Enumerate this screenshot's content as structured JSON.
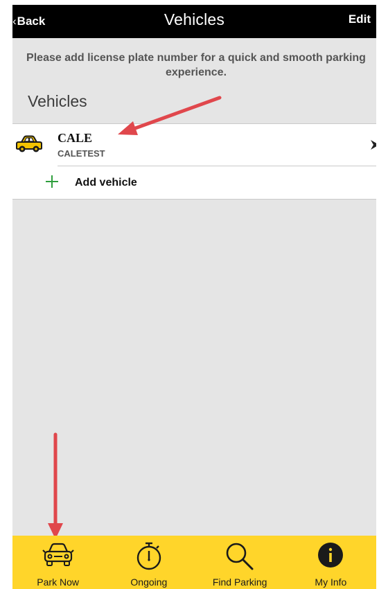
{
  "navbar": {
    "back_label": "Back",
    "title": "Vehicles",
    "edit_label": "Edit"
  },
  "info_message": "Please add license plate number for a quick and smooth parking experience.",
  "section_title": "Vehicles",
  "vehicles": [
    {
      "name": "CALE",
      "plate": "CALETEST",
      "icon": "car-icon"
    }
  ],
  "add_vehicle": {
    "label": "Add vehicle",
    "icon": "plus-icon"
  },
  "tabs": [
    {
      "label": "Park Now",
      "icon": "car-front-icon"
    },
    {
      "label": "Ongoing",
      "icon": "stopwatch-icon"
    },
    {
      "label": "Find Parking",
      "icon": "search-icon"
    },
    {
      "label": "My Info",
      "icon": "info-icon"
    }
  ],
  "colors": {
    "navbar_bg": "#000000",
    "screen_bg": "#e5e5e5",
    "tabbar_bg": "#ffd52a",
    "car_icon_yellow": "#f4c400",
    "plus_green": "#2e9e3c",
    "annotation_arrow": "#e0474c"
  }
}
